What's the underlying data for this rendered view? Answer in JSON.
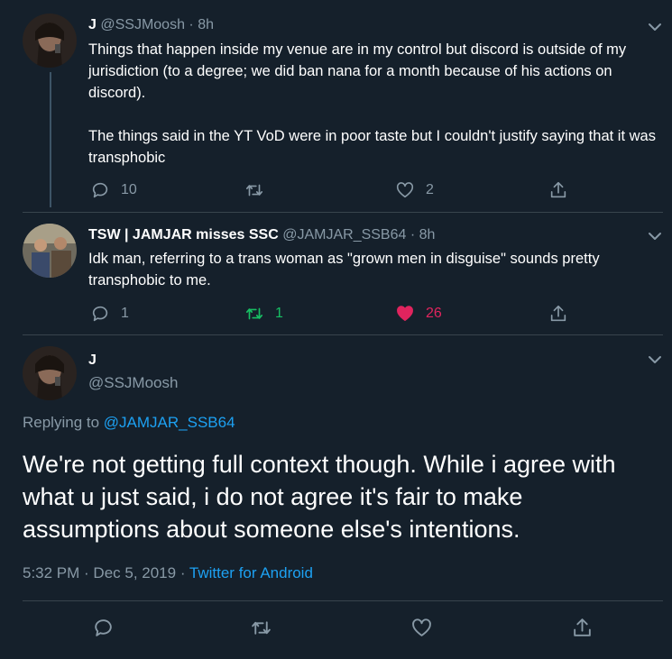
{
  "tweets": [
    {
      "name": "J",
      "handle": "@SSJMoosh",
      "time": "· 8h",
      "text_p1": "Things that happen inside my venue are in my control but discord is outside of my jurisdiction (to a degree; we did ban nana for a month because of his actions on discord).",
      "text_p2": "The things said in the YT VoD were in poor taste but I couldn't justify saying that it was transphobic",
      "replies": "10",
      "retweets": "",
      "likes": "2"
    },
    {
      "name": "TSW | JAMJAR misses SSC",
      "handle": "@JAMJAR_SSB64",
      "time": "· 8h",
      "text": "Idk man, referring to a trans woman as \"grown men in disguise\" sounds pretty transphobic to me.",
      "replies": "1",
      "retweets": "1",
      "likes": "26"
    }
  ],
  "main_tweet": {
    "name": "J",
    "handle": "@SSJMoosh",
    "replying_prefix": "Replying to",
    "replying_to": "@JAMJAR_SSB64",
    "text": "We're not getting full context though. While i agree with what u just said, i do not agree it's fair to make assumptions about someone else's intentions.",
    "date": "5:32 PM · Dec 5, 2019 ·",
    "source": "Twitter for Android"
  },
  "colors": {
    "background": "#15202b",
    "link": "#1da1f2",
    "secondary_text": "#8899a6",
    "retweet_active": "#17bf63",
    "like_active": "#e0245e"
  },
  "icons": [
    "avatar",
    "chevron-down-icon",
    "reply-icon",
    "retweet-icon",
    "like-icon",
    "share-icon"
  ]
}
